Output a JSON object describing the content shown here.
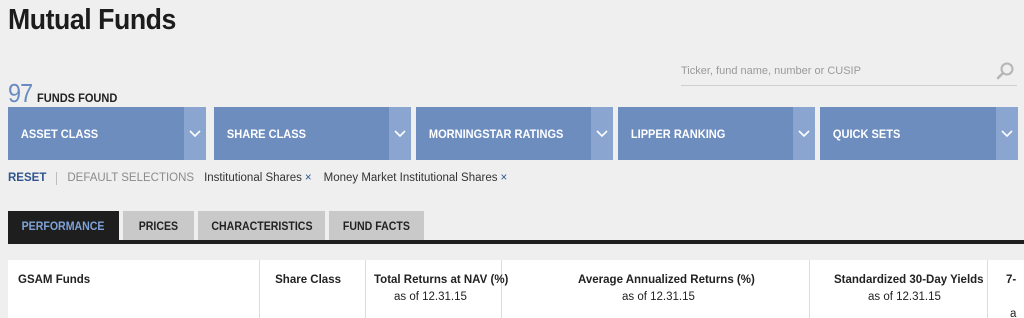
{
  "page": {
    "title": "Mutual Funds"
  },
  "search": {
    "placeholder": "Ticker, fund name, number or CUSIP"
  },
  "results": {
    "count": "97",
    "label": "FUNDS FOUND"
  },
  "filters": [
    {
      "label": "ASSET CLASS"
    },
    {
      "label": "SHARE CLASS"
    },
    {
      "label": "MORNINGSTAR RATINGS"
    },
    {
      "label": "LIPPER RANKING"
    },
    {
      "label": "QUICK SETS"
    }
  ],
  "selections": {
    "reset": "RESET",
    "default": "DEFAULT SELECTIONS",
    "chips": [
      {
        "label": "Institutional Shares",
        "remove": "×"
      },
      {
        "label": "Money Market Institutional Shares",
        "remove": "×"
      }
    ]
  },
  "tabs": [
    {
      "label": "PERFORMANCE",
      "active": true
    },
    {
      "label": "PRICES"
    },
    {
      "label": "CHARACTERISTICS"
    },
    {
      "label": "FUND FACTS"
    }
  ],
  "table": {
    "columns": [
      {
        "header": "GSAM Funds",
        "sub": ""
      },
      {
        "header": "Share Class",
        "sub": ""
      },
      {
        "header": "Total Returns at NAV (%)",
        "sub": "as of 12.31.15"
      },
      {
        "header": "Average Annualized Returns (%)",
        "sub": "as of 12.31.15"
      },
      {
        "header": "Standardized 30-Day Yields",
        "sub": "as of 12.31.15"
      },
      {
        "header": "7-",
        "sub": "a"
      }
    ]
  },
  "colors": {
    "accent": "#6d8dbf",
    "link": "#2f558f",
    "active_tab": "#1e1e1e"
  }
}
